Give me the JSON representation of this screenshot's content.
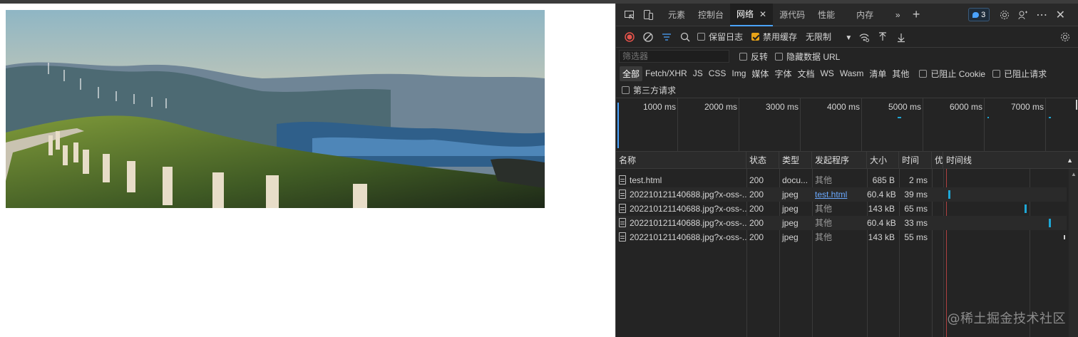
{
  "devtools": {
    "tabs": [
      {
        "label": "元素"
      },
      {
        "label": "控制台"
      },
      {
        "label": "网络"
      },
      {
        "label": "源代码"
      },
      {
        "label": "性能"
      },
      {
        "label": "内存"
      }
    ],
    "issues_count": "3",
    "toolbar": {
      "preserve_log": "保留日志",
      "disable_cache": "禁用缓存",
      "throttling": "无限制"
    },
    "filter": {
      "placeholder": "筛选器",
      "invert": "反转",
      "hide_data_urls": "隐藏数据 URL"
    },
    "type_filters": [
      "全部",
      "Fetch/XHR",
      "JS",
      "CSS",
      "Img",
      "媒体",
      "字体",
      "文档",
      "WS",
      "Wasm",
      "清单",
      "其他"
    ],
    "blocked_cookies": "已阻止 Cookie",
    "blocked_requests": "已阻止请求",
    "third_party": "第三方请求",
    "overview_labels": [
      "1000 ms",
      "2000 ms",
      "3000 ms",
      "4000 ms",
      "5000 ms",
      "6000 ms",
      "7000 ms"
    ],
    "columns": {
      "name": "名称",
      "status": "状态",
      "type": "类型",
      "initiator": "发起程序",
      "size": "大小",
      "time": "时间",
      "priority": "优",
      "waterfall": "时间线"
    },
    "rows": [
      {
        "name": "test.html",
        "status": "200",
        "type": "docu...",
        "initiator": "其他",
        "size": "685 B",
        "time": "2 ms"
      },
      {
        "name": "20221012114068​8.jpg?x-oss-...",
        "status": "200",
        "type": "jpeg",
        "initiator": "test.html",
        "size": "60.4 kB",
        "time": "39 ms"
      },
      {
        "name": "202210121140688.jpg?x-oss-...",
        "status": "200",
        "type": "jpeg",
        "initiator": "其他",
        "size": "143 kB",
        "time": "65 ms"
      },
      {
        "name": "202210121140688.jpg?x-oss-...",
        "status": "200",
        "type": "jpeg",
        "initiator": "其他",
        "size": "60.4 kB",
        "time": "33 ms"
      },
      {
        "name": "202210121140688.jpg?x-oss-...",
        "status": "200",
        "type": "jpeg",
        "initiator": "其他",
        "size": "143 kB",
        "time": "55 ms"
      }
    ]
  },
  "watermark": "@稀土掘金技术社区",
  "colors": {
    "accent": "#4aa3ff",
    "record": "#e5534b",
    "checkbox": "#e8a317",
    "link": "#6aa9ff",
    "waterfall": "#1ea7d6"
  }
}
